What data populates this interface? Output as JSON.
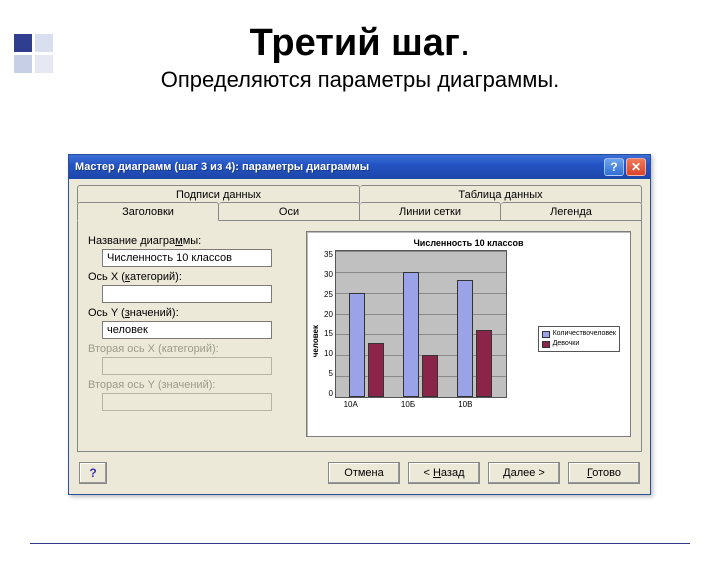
{
  "page": {
    "title": "Третий шаг",
    "title_dot": ".",
    "subtitle": "Определяются параметры диаграммы."
  },
  "window": {
    "title": "Мастер диаграмм (шаг 3 из 4): параметры диаграммы"
  },
  "tabs": {
    "row_top": [
      "Подписи данных",
      "Таблица данных"
    ],
    "row_bottom": [
      "Заголовки",
      "Оси",
      "Линии сетки",
      "Легенда"
    ],
    "selected": "Заголовки"
  },
  "form": {
    "chart_title_label": "Название диаграммы:",
    "chart_title_value": "Численность 10 классов",
    "axis_x_label": "Ось X (категорий):",
    "axis_x_value": "",
    "axis_y_label": "Ось Y (значений):",
    "axis_y_value": "человек",
    "axis_x2_label": "Вторая ось X (категорий):",
    "axis_x2_value": "",
    "axis_y2_label": "Вторая ось Y (значений):",
    "axis_y2_value": ""
  },
  "chart_data": {
    "type": "bar",
    "title": "Численность 10 классов",
    "ylabel": "человек",
    "xlabel": "",
    "categories": [
      "10А",
      "10Б",
      "10В"
    ],
    "series": [
      {
        "name": "Количествочеловек",
        "values": [
          25,
          30,
          28
        ]
      },
      {
        "name": "Девочки",
        "values": [
          13,
          10,
          16
        ]
      }
    ],
    "yticks": [
      "35",
      "30",
      "25",
      "20",
      "15",
      "10",
      "5",
      "0"
    ],
    "ylim": [
      0,
      35
    ]
  },
  "buttons": {
    "cancel": "Отмена",
    "back": "< Назад",
    "next": "Далее >",
    "finish": "Готово"
  }
}
